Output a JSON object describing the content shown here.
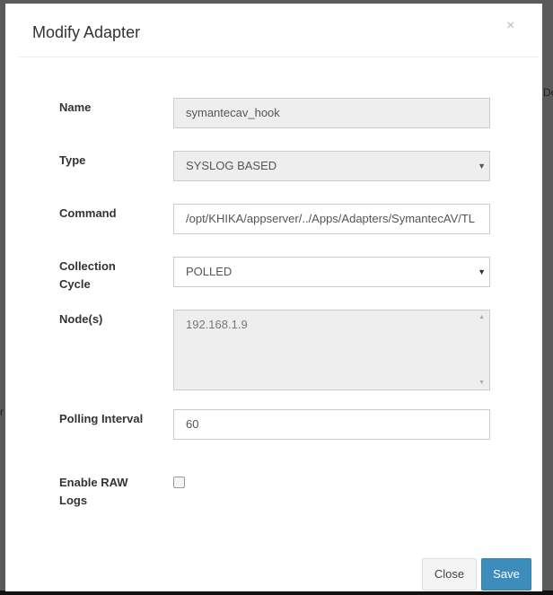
{
  "background": {
    "text_right": "De",
    "text_left": "r"
  },
  "modal": {
    "title": "Modify Adapter",
    "close_icon": "×",
    "fields": {
      "name": {
        "label": "Name",
        "value": "symantecav_hook"
      },
      "type": {
        "label": "Type",
        "value": "SYSLOG BASED"
      },
      "command": {
        "label": "Command",
        "value": "/opt/KHIKA/appserver/../Apps/Adapters/SymantecAV/TL"
      },
      "collection_cycle": {
        "label": "Collection Cycle",
        "value": "POLLED"
      },
      "nodes": {
        "label": "Node(s)",
        "value": "192.168.1.9"
      },
      "polling_interval": {
        "label": "Polling Interval",
        "value": "60"
      },
      "enable_raw_logs": {
        "label": "Enable RAW Logs",
        "checked": false
      }
    },
    "buttons": {
      "close": "Close",
      "save": "Save"
    },
    "colors": {
      "save_button": "#3c8dbc"
    }
  }
}
